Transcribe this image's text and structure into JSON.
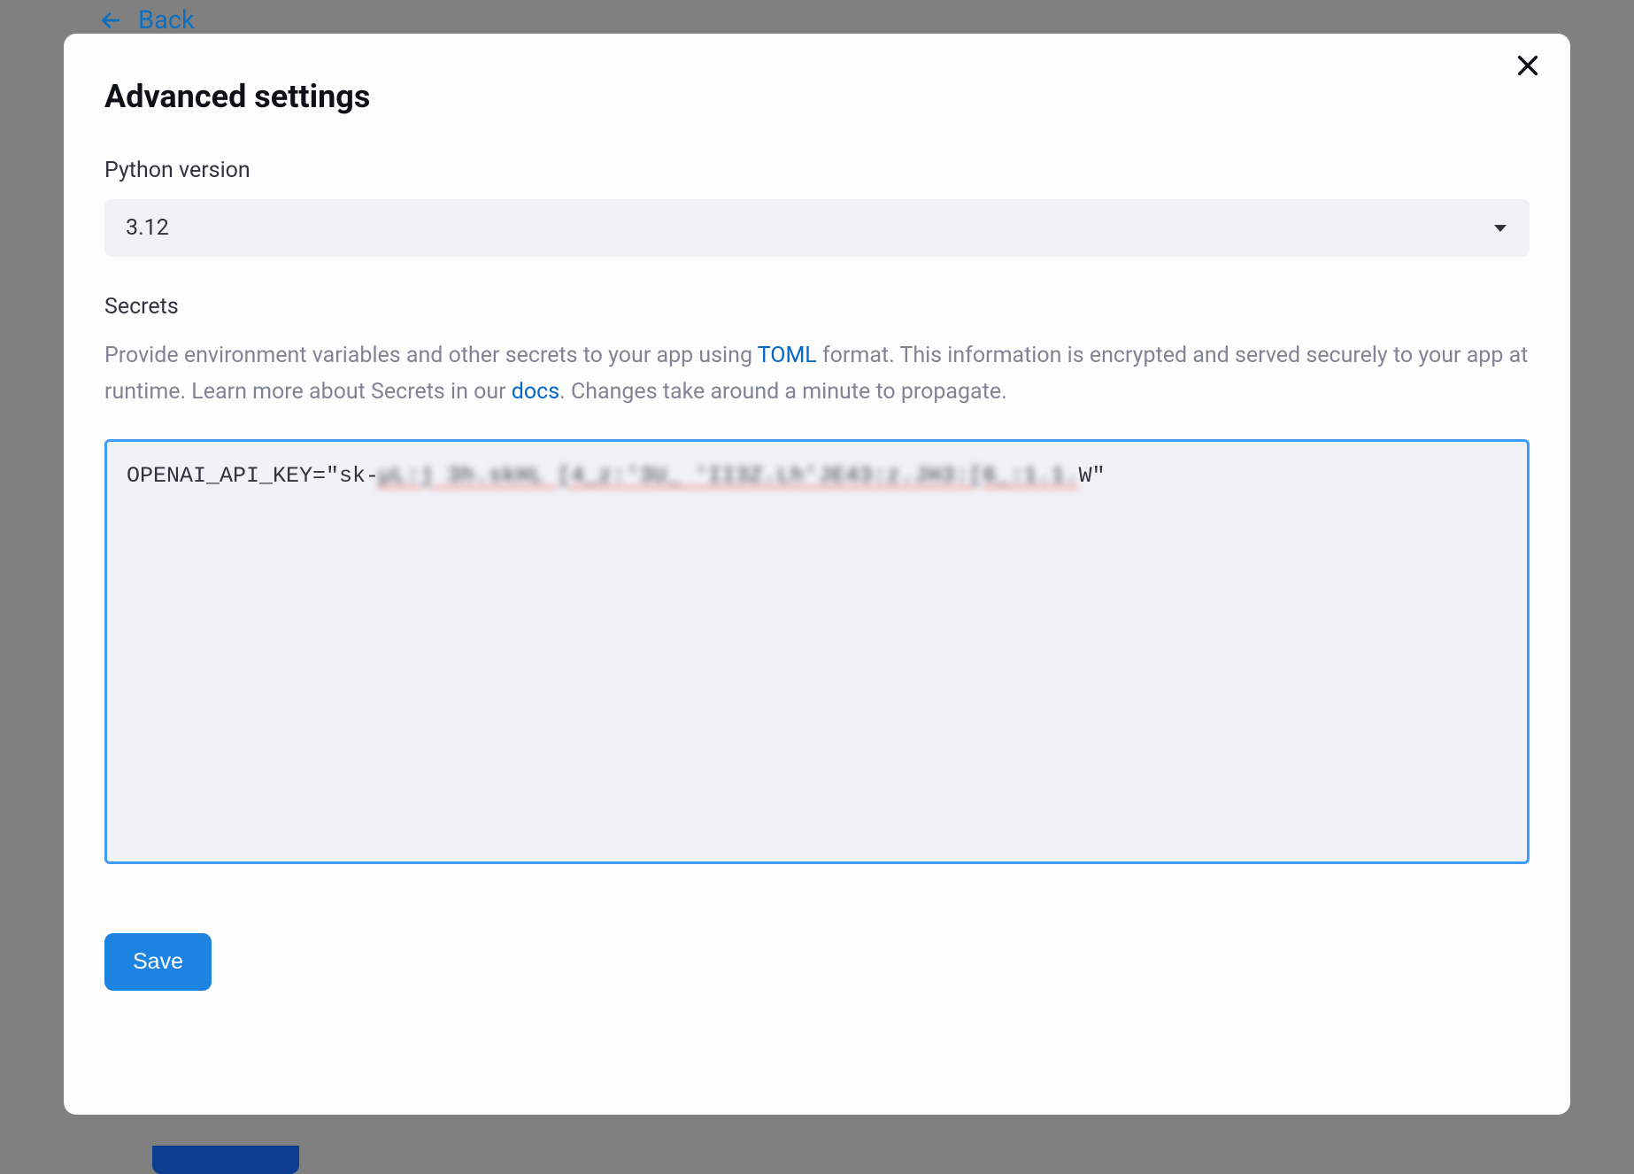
{
  "back": {
    "label": "Back"
  },
  "modal": {
    "title": "Advanced settings",
    "python_version": {
      "label": "Python version",
      "value": "3.12"
    },
    "secrets": {
      "label": "Secrets",
      "description_pre": "Provide environment variables and other secrets to your app using ",
      "toml_link": "TOML",
      "description_mid": " format. This information is encrypted and served securely to your app at runtime. Learn more about Secrets in our ",
      "docs_link": "docs",
      "description_post": ". Changes take around a minute to propagate.",
      "value_prefix": "OPENAI_API_KEY=\"sk-",
      "value_redacted": "µL:j 3h.skHL [4_z:'3U_ 'II3Z.Lh'JE43:z.JH3:[6_:1.1.",
      "value_suffix": "W\""
    },
    "save_label": "Save"
  }
}
